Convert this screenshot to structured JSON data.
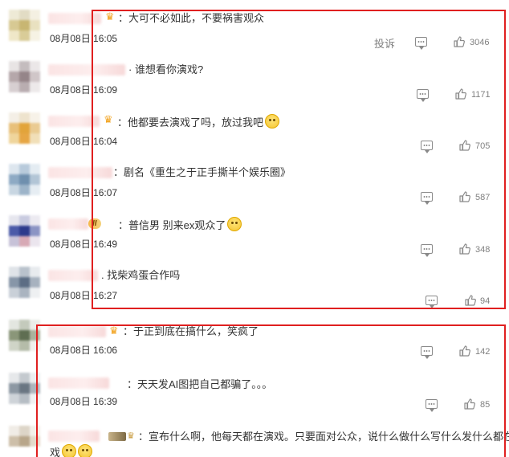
{
  "comments": [
    {
      "text": "：大可不必如此，不要祸害观众",
      "time": "08月08日 16:05",
      "report": "投诉",
      "likes": "3046",
      "badge": "crown"
    },
    {
      "text": "· 谁想看你演戏?",
      "time": "08月08日 16:09",
      "likes": "1171",
      "badge": "none"
    },
    {
      "text": "：他都要去演戏了吗，放过我吧",
      "time": "08月08日 16:04",
      "likes": "705",
      "badge": "crown",
      "emoji": "grin-emoji"
    },
    {
      "text": "：剧名《重生之于正手撕半个娱乐圈》",
      "time": "08月08日 16:07",
      "likes": "587",
      "badge": "none"
    },
    {
      "text": "：普信男 别来ex观众了",
      "time": "08月08日 16:49",
      "likes": "348",
      "badge": "pill",
      "emoji": "smile-emoji"
    },
    {
      "text": ". 找柴鸡蛋合作吗",
      "time": "08月08日 16:27",
      "likes": "94",
      "badge": "none"
    },
    {
      "text": "：于正到底在搞什么，笑疯了",
      "time": "08月08日 16:06",
      "likes": "142",
      "badge": "crown"
    },
    {
      "text": "：天天发AI图把自己都骗了。。。",
      "time": "08月08日 16:39",
      "likes": "85",
      "badge": "none"
    },
    {
      "text_line1": "：宣布什么啊，他每天都在演戏。只要面对公众，说什么做什么写什么发什么都在演",
      "text_line2": "戏",
      "badge": "gray",
      "emoji": "blush-emoji"
    }
  ],
  "badge_pill_label": "II",
  "colors": {
    "highlight_frame": "#e02020",
    "icon_gray": "#8a8a8a",
    "text": "#333333",
    "meta": "#808080"
  }
}
